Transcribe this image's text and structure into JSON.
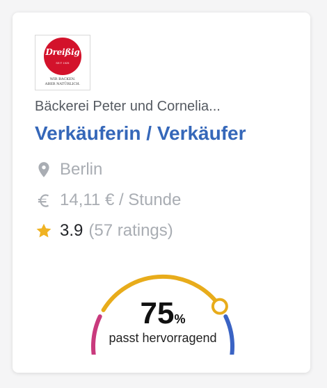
{
  "logo": {
    "brand": "Dreißig",
    "since": "SEIT 1925",
    "tagline_line1": "WIR BACKEN.",
    "tagline_line2": "ABER NATÜRLICH.",
    "brand_color": "#d3122b"
  },
  "company": "Bäckerei Peter und Cornelia...",
  "job_title": "Verkäuferin / Verkäufer",
  "location": {
    "icon": "map-pin-icon",
    "text": "Berlin"
  },
  "salary": {
    "icon": "euro-icon",
    "text": "14,11 € / Stunde"
  },
  "rating": {
    "icon": "star-icon",
    "value": "3.9",
    "count": "(57 ratings)"
  },
  "match": {
    "percent_number": "75",
    "percent_sign": "%",
    "label": "passt hervorragend",
    "value_fraction": 0.75
  },
  "colors": {
    "title": "#3567b9",
    "star": "#f0b323",
    "gauge_pink": "#c93a7d",
    "gauge_yellow": "#e8ac1b",
    "gauge_blue": "#3a63c4"
  }
}
